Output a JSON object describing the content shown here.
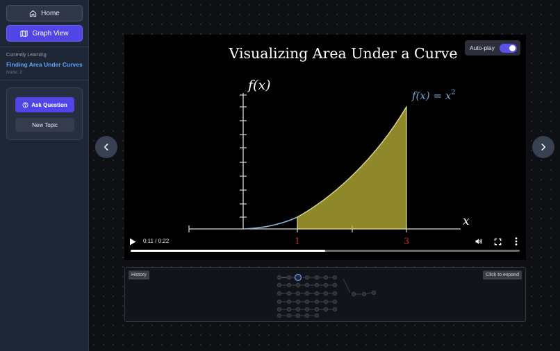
{
  "sidebar": {
    "home_label": "Home",
    "graph_label": "Graph View",
    "currently_learning_label": "Currently Learning",
    "current_topic": "Finding Area Under Curves",
    "node_label": "Node: 2",
    "ask_label": "Ask Question",
    "new_topic_label": "New Topic"
  },
  "video": {
    "title": "Visualizing Area Under a Curve",
    "y_axis_label": "f(x)",
    "x_axis_label": "x",
    "curve_label_lhs": "f(x) = x",
    "curve_label_exp": "2",
    "tick_left": "1",
    "tick_right": "3",
    "autoplay_label": "Auto-play",
    "autoplay_on": true,
    "time": "0:11 / 0:22",
    "progress": 0.5,
    "colors": {
      "fill": "#bfb63a",
      "curve": "#86b5d6",
      "label": "#6fa8d8",
      "tick_red": "#b42f2f"
    }
  },
  "history": {
    "tag": "History",
    "expand_label": "Click to expand"
  },
  "icons": {
    "home": "home-icon",
    "graph": "map-icon",
    "ask": "help-circle-icon",
    "prev": "chevron-left-icon",
    "next": "chevron-right-icon",
    "play": "play-icon",
    "volume": "volume-icon",
    "fullscreen": "fullscreen-icon",
    "more": "more-vertical-icon"
  }
}
